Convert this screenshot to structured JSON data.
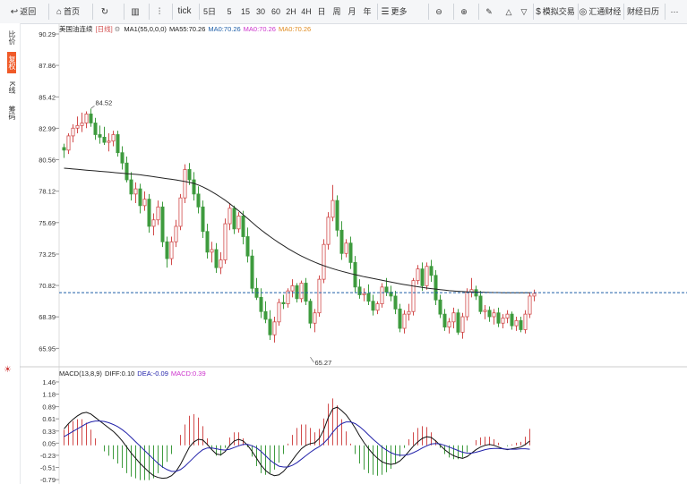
{
  "toolbar": {
    "back": "返回",
    "home": "首页",
    "refresh_icon": "refresh-icon",
    "kline_icon": "candlestick-icon",
    "tick": "tick",
    "periods": [
      "5日",
      "5",
      "15",
      "30",
      "60",
      "2H",
      "4H",
      "日",
      "周",
      "月",
      "年"
    ],
    "more": "更多",
    "sim_trade": "模拟交易",
    "fx": "汇通财经",
    "calendar": "财经日历"
  },
  "sidebar": {
    "items": [
      "比价",
      "复权",
      "K线",
      "筹码"
    ]
  },
  "main_legend": {
    "symbol": "美国油连续",
    "period": "[日线]",
    "ma1": "MA1(55,0,0,0)",
    "ma55": "MA55:70.26",
    "ma0a": "MA0:70.26",
    "ma0b": "MA0:70.26",
    "ma0c": "MA0:70.26"
  },
  "macd_legend": {
    "title": "MACD(13,8,9)",
    "diff": "DIFF:0.10",
    "dea": "DEA:-0.09",
    "macd": "MACD:0.39"
  },
  "colors": {
    "up": "#d14b4b",
    "down": "#3e9b3e",
    "ma": "#222222",
    "current_line": "#1f5fa8",
    "dea": "#2222aa",
    "macd_label": "#cc33cc"
  },
  "chart_data": [
    {
      "type": "candlestick",
      "title": "美国油连续 [日线]",
      "y_ticks": [
        90.29,
        87.86,
        85.42,
        82.99,
        80.56,
        78.12,
        75.69,
        73.25,
        70.82,
        68.39,
        65.95
      ],
      "ylim": [
        64.8,
        90.29
      ],
      "current_price": 70.26,
      "annotations": [
        {
          "label": "84.52",
          "value": 84.52,
          "index": 6
        },
        {
          "label": "65.27",
          "value": 65.27,
          "index": 55
        }
      ],
      "candles": [
        [
          81.5,
          81.8,
          80.7,
          81.3
        ],
        [
          81.3,
          82.6,
          81.0,
          82.4
        ],
        [
          82.4,
          83.3,
          81.9,
          83.0
        ],
        [
          83.0,
          83.9,
          82.6,
          83.2
        ],
        [
          83.2,
          84.2,
          82.7,
          83.4
        ],
        [
          83.4,
          84.3,
          83.0,
          84.1
        ],
        [
          84.1,
          84.5,
          83.1,
          83.4
        ],
        [
          83.4,
          83.8,
          82.1,
          82.5
        ],
        [
          82.5,
          83.2,
          81.8,
          82.3
        ],
        [
          82.3,
          83.1,
          81.7,
          81.9
        ],
        [
          81.9,
          82.6,
          81.2,
          82.0
        ],
        [
          82.0,
          82.8,
          81.6,
          82.5
        ],
        [
          82.5,
          82.8,
          80.8,
          81.1
        ],
        [
          81.1,
          81.6,
          79.8,
          80.3
        ],
        [
          80.3,
          80.8,
          78.8,
          79.0
        ],
        [
          79.0,
          79.6,
          77.4,
          77.9
        ],
        [
          77.9,
          78.8,
          77.2,
          78.3
        ],
        [
          78.3,
          78.7,
          76.4,
          77.0
        ],
        [
          77.0,
          78.1,
          76.6,
          77.5
        ],
        [
          77.5,
          77.9,
          74.9,
          75.4
        ],
        [
          75.4,
          76.4,
          74.7,
          75.9
        ],
        [
          75.9,
          77.4,
          75.5,
          76.9
        ],
        [
          76.9,
          77.3,
          73.8,
          74.2
        ],
        [
          74.2,
          74.6,
          72.2,
          72.9
        ],
        [
          72.9,
          74.6,
          72.4,
          74.2
        ],
        [
          74.2,
          75.9,
          73.8,
          75.4
        ],
        [
          75.4,
          77.9,
          75.1,
          77.6
        ],
        [
          77.6,
          80.2,
          77.2,
          79.8
        ],
        [
          79.8,
          80.3,
          78.6,
          79.0
        ],
        [
          79.0,
          79.6,
          77.4,
          77.9
        ],
        [
          77.9,
          78.5,
          76.4,
          76.9
        ],
        [
          76.9,
          77.4,
          74.5,
          75.0
        ],
        [
          75.0,
          75.6,
          72.9,
          73.4
        ],
        [
          73.4,
          74.2,
          72.6,
          73.6
        ],
        [
          73.6,
          74.1,
          71.8,
          72.2
        ],
        [
          72.2,
          73.4,
          71.7,
          72.8
        ],
        [
          72.8,
          76.0,
          72.5,
          75.6
        ],
        [
          75.6,
          77.2,
          75.1,
          76.8
        ],
        [
          76.8,
          77.0,
          74.8,
          75.2
        ],
        [
          75.2,
          76.5,
          74.9,
          76.2
        ],
        [
          76.2,
          76.6,
          74.0,
          74.6
        ],
        [
          74.6,
          75.3,
          72.6,
          73.1
        ],
        [
          73.1,
          73.6,
          70.2,
          70.6
        ],
        [
          70.6,
          71.4,
          69.7,
          69.9
        ],
        [
          69.9,
          70.6,
          68.3,
          68.8
        ],
        [
          68.8,
          69.6,
          67.9,
          68.2
        ],
        [
          68.2,
          68.9,
          66.6,
          67.0
        ],
        [
          67.0,
          68.4,
          66.4,
          68.0
        ],
        [
          68.0,
          69.8,
          67.7,
          69.5
        ],
        [
          69.5,
          70.1,
          69.0,
          69.4
        ],
        [
          69.4,
          70.6,
          69.1,
          70.4
        ],
        [
          70.4,
          71.3,
          69.9,
          70.8
        ],
        [
          70.8,
          71.0,
          69.5,
          69.8
        ],
        [
          69.8,
          71.2,
          69.5,
          71.0
        ],
        [
          71.0,
          71.4,
          69.3,
          69.6
        ],
        [
          69.6,
          69.8,
          67.5,
          67.9
        ],
        [
          67.9,
          69.0,
          67.2,
          68.7
        ],
        [
          68.7,
          71.6,
          68.4,
          71.3
        ],
        [
          71.3,
          74.4,
          71.0,
          74.0
        ],
        [
          74.0,
          76.5,
          73.6,
          76.1
        ],
        [
          76.1,
          78.6,
          75.8,
          77.4
        ],
        [
          77.4,
          77.8,
          74.6,
          75.1
        ],
        [
          75.1,
          75.8,
          72.8,
          73.3
        ],
        [
          73.3,
          74.4,
          73.0,
          74.1
        ],
        [
          74.1,
          74.6,
          72.1,
          72.6
        ],
        [
          72.6,
          73.1,
          70.3,
          70.7
        ],
        [
          70.7,
          71.3,
          69.8,
          70.1
        ],
        [
          70.1,
          70.6,
          69.6,
          70.2
        ],
        [
          70.2,
          70.9,
          69.3,
          69.6
        ],
        [
          69.6,
          70.1,
          68.5,
          68.9
        ],
        [
          68.9,
          69.6,
          68.6,
          69.4
        ],
        [
          69.4,
          71.0,
          69.1,
          70.7
        ],
        [
          70.7,
          71.4,
          70.0,
          70.3
        ],
        [
          70.3,
          70.8,
          69.6,
          70.0
        ],
        [
          70.0,
          70.4,
          68.6,
          69.0
        ],
        [
          69.0,
          69.4,
          67.2,
          67.5
        ],
        [
          67.5,
          68.9,
          67.1,
          68.6
        ],
        [
          68.6,
          69.4,
          68.1,
          68.8
        ],
        [
          68.8,
          71.4,
          68.5,
          71.2
        ],
        [
          71.2,
          72.4,
          70.9,
          72.1
        ],
        [
          72.1,
          72.6,
          70.4,
          70.8
        ],
        [
          70.8,
          72.6,
          70.5,
          72.3
        ],
        [
          72.3,
          72.8,
          71.1,
          71.6
        ],
        [
          71.6,
          72.0,
          69.3,
          69.7
        ],
        [
          69.7,
          70.1,
          68.3,
          68.6
        ],
        [
          68.6,
          69.0,
          67.3,
          67.6
        ],
        [
          67.6,
          68.3,
          67.1,
          68.0
        ],
        [
          68.0,
          69.1,
          67.5,
          68.7
        ],
        [
          68.7,
          69.0,
          67.0,
          67.2
        ],
        [
          67.2,
          68.7,
          66.7,
          68.4
        ],
        [
          68.4,
          70.6,
          68.1,
          70.3
        ],
        [
          70.3,
          71.4,
          69.9,
          70.5
        ],
        [
          70.5,
          70.8,
          69.7,
          70.0
        ],
        [
          70.0,
          70.4,
          68.6,
          68.8
        ],
        [
          68.8,
          69.3,
          68.2,
          68.9
        ],
        [
          68.9,
          69.2,
          68.0,
          68.4
        ],
        [
          68.4,
          69.0,
          67.8,
          68.7
        ],
        [
          68.7,
          69.1,
          67.6,
          67.9
        ],
        [
          67.9,
          68.6,
          67.5,
          68.3
        ],
        [
          68.3,
          68.9,
          67.9,
          68.6
        ],
        [
          68.6,
          68.8,
          67.4,
          67.7
        ],
        [
          67.7,
          68.4,
          67.3,
          68.1
        ],
        [
          68.1,
          68.4,
          67.2,
          67.4
        ],
        [
          67.4,
          68.9,
          67.1,
          68.6
        ],
        [
          68.6,
          70.3,
          68.3,
          70.0
        ],
        [
          70.0,
          70.5,
          69.6,
          70.2
        ]
      ],
      "ma": [
        79.9,
        79.87,
        79.84,
        79.81,
        79.78,
        79.75,
        79.72,
        79.69,
        79.66,
        79.63,
        79.6,
        79.57,
        79.54,
        79.51,
        79.48,
        79.45,
        79.42,
        79.39,
        79.34,
        79.29,
        79.24,
        79.19,
        79.14,
        79.09,
        79.04,
        78.99,
        78.93,
        78.87,
        78.8,
        78.72,
        78.6,
        78.45,
        78.27,
        78.08,
        77.87,
        77.65,
        77.41,
        77.15,
        76.88,
        76.6,
        76.3,
        76.0,
        75.7,
        75.4,
        75.12,
        74.86,
        74.6,
        74.36,
        74.12,
        73.9,
        73.68,
        73.48,
        73.28,
        73.1,
        72.93,
        72.77,
        72.62,
        72.48,
        72.35,
        72.23,
        72.12,
        72.02,
        71.92,
        71.83,
        71.74,
        71.66,
        71.58,
        71.5,
        71.43,
        71.36,
        71.29,
        71.22,
        71.15,
        71.08,
        71.01,
        70.95,
        70.89,
        70.83,
        70.77,
        70.72,
        70.67,
        70.62,
        70.58,
        70.54,
        70.5,
        70.46,
        70.42,
        70.39,
        70.37,
        70.35,
        70.33,
        70.32,
        70.31,
        70.3,
        70.29,
        70.28,
        70.27,
        70.27,
        70.26,
        70.26,
        70.26,
        70.26,
        70.26,
        70.26,
        70.26
      ]
    },
    {
      "type": "macd",
      "title": "MACD(13,8,9)",
      "y_ticks": [
        1.46,
        1.18,
        0.89,
        0.61,
        0.33,
        0.05,
        -0.23,
        -0.51,
        -0.79
      ],
      "ylim": [
        -0.85,
        1.5
      ],
      "diff": [
        0.38,
        0.5,
        0.6,
        0.68,
        0.74,
        0.76,
        0.72,
        0.64,
        0.56,
        0.48,
        0.4,
        0.32,
        0.22,
        0.1,
        -0.04,
        -0.18,
        -0.3,
        -0.42,
        -0.52,
        -0.62,
        -0.7,
        -0.74,
        -0.76,
        -0.75,
        -0.7,
        -0.6,
        -0.44,
        -0.24,
        -0.04,
        0.08,
        0.14,
        0.12,
        0.02,
        -0.1,
        -0.2,
        -0.22,
        -0.14,
        0.0,
        0.1,
        0.14,
        0.1,
        0.0,
        -0.14,
        -0.3,
        -0.46,
        -0.58,
        -0.66,
        -0.7,
        -0.68,
        -0.6,
        -0.48,
        -0.34,
        -0.2,
        -0.08,
        0.0,
        0.04,
        0.06,
        0.16,
        0.36,
        0.64,
        0.84,
        0.88,
        0.8,
        0.7,
        0.56,
        0.4,
        0.22,
        0.06,
        -0.08,
        -0.2,
        -0.3,
        -0.38,
        -0.42,
        -0.44,
        -0.42,
        -0.36,
        -0.26,
        -0.14,
        -0.02,
        0.08,
        0.16,
        0.2,
        0.18,
        0.1,
        0.0,
        -0.1,
        -0.18,
        -0.24,
        -0.28,
        -0.3,
        -0.26,
        -0.18,
        -0.1,
        -0.04,
        0.0,
        0.02,
        0.0,
        -0.04,
        -0.08,
        -0.1,
        -0.08,
        -0.06,
        -0.04,
        0.02,
        0.1
      ],
      "dea": [
        0.2,
        0.26,
        0.32,
        0.38,
        0.44,
        0.5,
        0.54,
        0.56,
        0.56,
        0.55,
        0.52,
        0.48,
        0.43,
        0.36,
        0.28,
        0.18,
        0.08,
        -0.02,
        -0.12,
        -0.22,
        -0.32,
        -0.42,
        -0.5,
        -0.56,
        -0.6,
        -0.6,
        -0.56,
        -0.48,
        -0.38,
        -0.28,
        -0.18,
        -0.1,
        -0.06,
        -0.06,
        -0.08,
        -0.1,
        -0.11,
        -0.09,
        -0.05,
        -0.01,
        0.02,
        0.02,
        -0.01,
        -0.06,
        -0.14,
        -0.24,
        -0.34,
        -0.42,
        -0.48,
        -0.5,
        -0.5,
        -0.46,
        -0.4,
        -0.32,
        -0.24,
        -0.16,
        -0.09,
        -0.03,
        0.05,
        0.16,
        0.3,
        0.42,
        0.5,
        0.54,
        0.54,
        0.5,
        0.43,
        0.34,
        0.24,
        0.14,
        0.05,
        -0.04,
        -0.11,
        -0.17,
        -0.21,
        -0.23,
        -0.23,
        -0.21,
        -0.17,
        -0.12,
        -0.06,
        -0.01,
        0.03,
        0.04,
        0.03,
        0.0,
        -0.04,
        -0.08,
        -0.12,
        -0.16,
        -0.18,
        -0.18,
        -0.16,
        -0.13,
        -0.1,
        -0.08,
        -0.07,
        -0.07,
        -0.08,
        -0.09,
        -0.09,
        -0.09,
        -0.08,
        -0.08,
        -0.09
      ]
    }
  ]
}
